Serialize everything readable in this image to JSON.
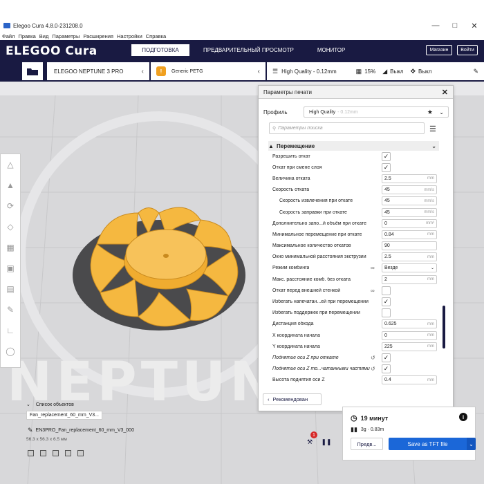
{
  "window": {
    "title": "Elegoo Cura 4.8.0-231208.0"
  },
  "menu": [
    "Файл",
    "Правка",
    "Вид",
    "Параметры",
    "Расширения",
    "Настройки",
    "Справка"
  ],
  "header": {
    "logo": "ELEGOO Cura",
    "stages": [
      "ПОДГОТОВКА",
      "ПРЕДВАРИТЕЛЬНЫЙ ПРОСМОТР",
      "МОНИТОР"
    ],
    "active_stage": 0,
    "store_label": "Магазин",
    "signin_label": "Войти"
  },
  "toolbar": {
    "printer": "ELEGOO NEPTUNE 3 PRO",
    "material": "Generic PETG",
    "profile": "High Quality - 0.12mm",
    "infill": "15%",
    "support": "Выкл",
    "adhesion": "Выкл"
  },
  "panel": {
    "title": "Параметры печати",
    "profile_label": "Профиль",
    "profile_value": "High Quality",
    "profile_sub": "- 0.12mm",
    "search_placeholder": "Параметры поиска",
    "category": "Перемещение",
    "recommended_label": "Рекомендован",
    "settings": [
      {
        "label": "Разрешить откат",
        "type": "check",
        "value": "✓"
      },
      {
        "label": "Откат при смене слоя",
        "type": "check",
        "value": "✓"
      },
      {
        "label": "Величина отката",
        "type": "value",
        "value": "2.5",
        "unit": "mm"
      },
      {
        "label": "Скорость отката",
        "type": "value",
        "value": "45",
        "unit": "mm/s"
      },
      {
        "label": "Скорость извлечения при откате",
        "type": "value",
        "value": "45",
        "unit": "mm/s",
        "indent": true
      },
      {
        "label": "Скорость заправки при откате",
        "type": "value",
        "value": "45",
        "unit": "mm/s",
        "indent": true
      },
      {
        "label": "Дополнительно запо...й объём при откате",
        "type": "value",
        "value": "0",
        "unit": "mm³"
      },
      {
        "label": "Минимальное перемещение при откате",
        "type": "value",
        "value": "0.84",
        "unit": "mm"
      },
      {
        "label": "Максимальное количество откатов",
        "type": "value",
        "value": "90",
        "unit": ""
      },
      {
        "label": "Окно минимальной расстояния экструзии",
        "type": "value",
        "value": "2.5",
        "unit": "mm"
      },
      {
        "label": "Режим комбинга",
        "type": "select",
        "value": "Везде",
        "linked": true
      },
      {
        "label": "Макс. расстояние комб. без отката",
        "type": "value",
        "value": "2",
        "unit": "mm"
      },
      {
        "label": "Откат перед внешней стенкой",
        "type": "check",
        "value": "",
        "linked": true
      },
      {
        "label": "Избегать напечатан...ей при перемещении",
        "type": "check",
        "value": "✓"
      },
      {
        "label": "Избегать поддержек при перемещении",
        "type": "check",
        "value": ""
      },
      {
        "label": "Дистанция обхода",
        "type": "value",
        "value": "0.625",
        "unit": "mm"
      },
      {
        "label": "X координата начала",
        "type": "value",
        "value": "0",
        "unit": "mm"
      },
      {
        "label": "Y координата начала",
        "type": "value",
        "value": "225",
        "unit": "mm"
      },
      {
        "label": "Поднятие оси Z при откате",
        "type": "check",
        "value": "✓",
        "italic": true,
        "reset": true
      },
      {
        "label": "Поднятие оси Z то...чатанными частями",
        "type": "check",
        "value": "✓",
        "italic": true,
        "reset": true
      },
      {
        "label": "Высота поднятия оси Z",
        "type": "value",
        "value": "0.4",
        "unit": "mm"
      }
    ]
  },
  "objects": {
    "list_label": "Список объектов",
    "chip": "Fan_replacement_60_mm_V3...",
    "full_name": "EN3PRO_Fan_replacement_60_mm_V3_000",
    "dimensions": "56.3 x 56.3 x 6.5 мм"
  },
  "action": {
    "time": "19 минут",
    "material": "3g · 0.83m",
    "preview_label": "Предв...",
    "save_label": "Save as TFT file",
    "badge_count": "1"
  },
  "watermark": "NEPTUNE",
  "colors": {
    "brand_dark": "#191a42",
    "accent_blue": "#1b67d8",
    "model_yellow": "#f5b840",
    "material_orange": "#f0a020"
  }
}
